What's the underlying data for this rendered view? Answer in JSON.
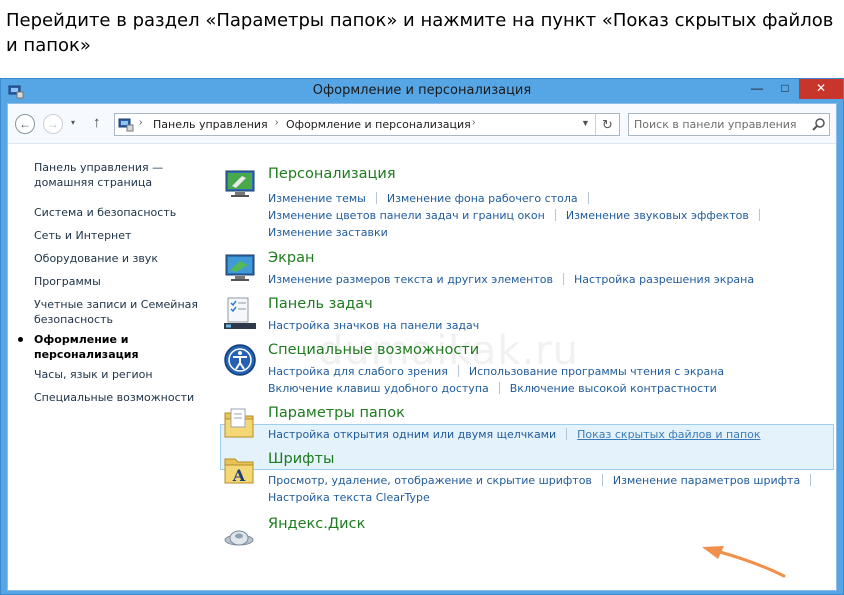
{
  "instruction": "Перейдите в раздел «Параметры папок» и нажмите на пункт «Показ скрытых файлов и папок»",
  "window": {
    "title": "Оформление и персонализация",
    "minimize": "—",
    "maximize": "□",
    "close": "✕"
  },
  "nav": {
    "back": "←",
    "forward": "→",
    "dropdown": "▾",
    "up": "↑",
    "breadcrumb": [
      "Панель управления",
      "Оформление и персонализация"
    ],
    "refresh": "↻",
    "search_placeholder": "Поиск в панели управления"
  },
  "sidebar": {
    "items": [
      {
        "label": "Панель управления — домашняя страница"
      },
      {
        "label": "Система и безопасность"
      },
      {
        "label": "Сеть и Интернет"
      },
      {
        "label": "Оборудование и звук"
      },
      {
        "label": "Программы"
      },
      {
        "label": "Учетные записи и Семейная безопасность"
      },
      {
        "label": "Оформление и персонализация"
      },
      {
        "label": "Часы, язык и регион"
      },
      {
        "label": "Специальные возможности"
      }
    ]
  },
  "categories": [
    {
      "title": "Персонализация",
      "links": [
        [
          "Изменение темы",
          "Изменение фона рабочего стола"
        ],
        [
          "Изменение цветов панели задач и границ окон",
          "Изменение звуковых эффектов"
        ],
        [
          "Изменение заставки"
        ]
      ]
    },
    {
      "title": "Экран",
      "links": [
        [
          "Изменение размеров текста и других элементов",
          "Настройка разрешения экрана"
        ]
      ]
    },
    {
      "title": "Панель задач",
      "links": [
        [
          "Настройка значков на панели задач"
        ]
      ]
    },
    {
      "title": "Специальные возможности",
      "links": [
        [
          "Настройка для слабого зрения",
          "Использование программы чтения с экрана"
        ],
        [
          "Включение клавиш удобного доступа",
          "Включение высокой контрастности"
        ]
      ]
    },
    {
      "title": "Параметры папок",
      "links": [
        [
          "Настройка открытия одним или двумя щелчками",
          "Показ скрытых файлов и папок"
        ]
      ]
    },
    {
      "title": "Шрифты",
      "links": [
        [
          "Просмотр, удаление, отображение и скрытие шрифтов",
          "Изменение параметров шрифта"
        ],
        [
          "Настройка текста ClearType"
        ]
      ]
    },
    {
      "title": "Яндекс.Диск",
      "links": []
    }
  ],
  "watermark": "dumaikak.ru",
  "colors": {
    "titlebar": "#56a6e6",
    "category_title": "#1e7b1e",
    "link": "#1f5b9a",
    "highlight_bg": "#e4f2fb",
    "highlight_border": "#9ccfee",
    "close_button": "#c7352b",
    "annotation_arrow": "#f0904a"
  }
}
